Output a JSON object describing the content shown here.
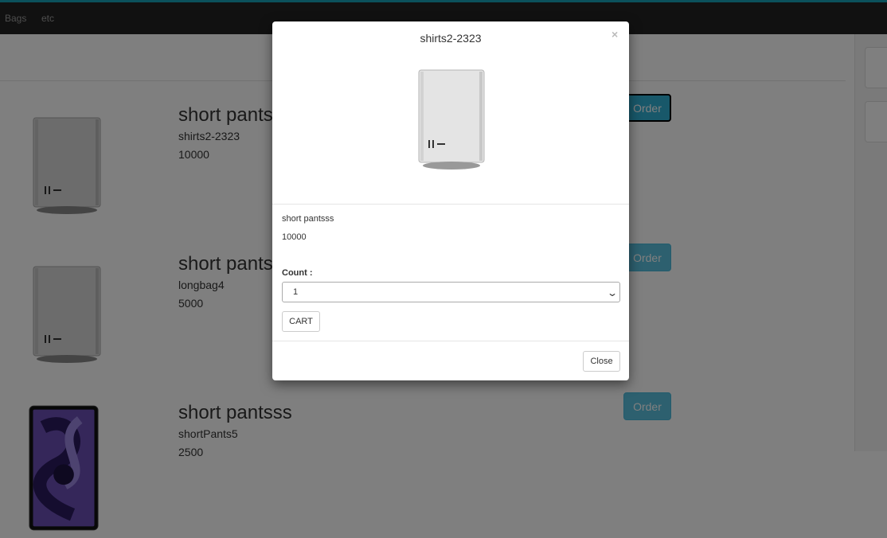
{
  "navbar": {
    "links": [
      "Bags",
      "etc"
    ]
  },
  "products": [
    {
      "title": "short pantsss",
      "code": "shirts2-2323",
      "price": "10000",
      "image": "mac-pro-icon",
      "order_label": "Order"
    },
    {
      "title": "short pantsss",
      "code": "longbag4",
      "price": "5000",
      "image": "mac-pro-icon",
      "order_label": "Order"
    },
    {
      "title": "short pantsss",
      "code": "shortPants5",
      "price": "2500",
      "image": "ipad-icon",
      "order_label": "Order"
    }
  ],
  "modal": {
    "title": "shirts2-2323",
    "close_x": "×",
    "product_name": "short pantsss",
    "product_price": "10000",
    "count_label": "Count :",
    "count_value": "1",
    "cart_label": "CART",
    "close_label": "Close"
  },
  "colors": {
    "accent": "#17a2b8",
    "navbar": "#222222",
    "order_button": "#5bc0de"
  }
}
